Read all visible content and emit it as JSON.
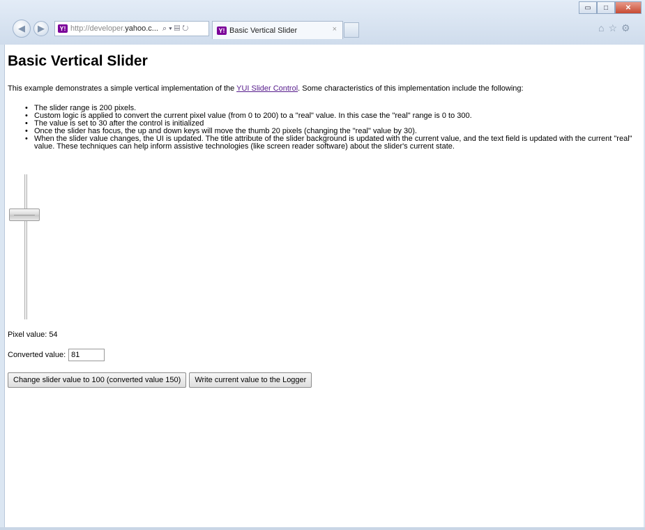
{
  "browser": {
    "url_prefix": "http://developer.",
    "url_domain": "yahoo.c...",
    "tab_title": "Basic Vertical Slider",
    "tab_close": "×",
    "search_icon": "⌕",
    "min_label": "▭",
    "max_label": "□",
    "close_label": "✕"
  },
  "page": {
    "title": "Basic Vertical Slider",
    "intro_before": "This example demonstrates a simple vertical implementation of the ",
    "intro_link": "YUI Slider Control",
    "intro_after": ". Some characteristics of this implementation include the following:",
    "features": [
      "The slider range is 200 pixels.",
      "Custom logic is applied to convert the current pixel value (from 0 to 200) to a \"real\" value. In this case the \"real\" range is 0 to 300.",
      "The value is set to 30 after the control is initialized",
      "Once the slider has focus, the up and down keys will move the thumb 20 pixels (changing the \"real\" value by 30).",
      "When the slider value changes, the UI is updated. The title attribute of the slider background is updated with the current value, and the text field is updated with the current \"real\" value. These techniques can help inform assistive technologies (like screen reader software) about the slider's current state."
    ],
    "slider": {
      "min": 0,
      "max": 200,
      "value": 54
    },
    "pixel_label": "Pixel value: ",
    "pixel_value": "54",
    "converted_label": "Converted value:",
    "converted_value": "81",
    "buttons": {
      "change": "Change slider value to 100 (converted value 150)",
      "log": "Write current value to the Logger"
    }
  }
}
